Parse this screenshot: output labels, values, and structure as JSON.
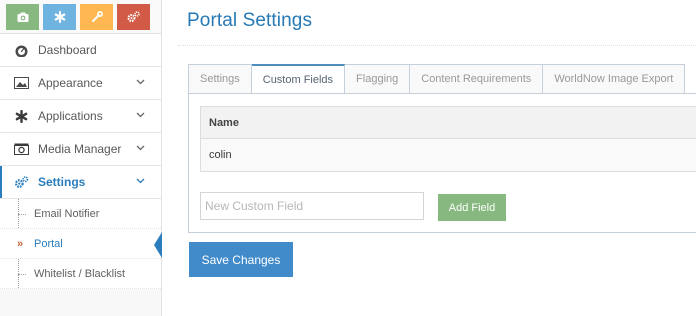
{
  "sidebar": {
    "shortcuts": [
      {
        "icon": "camera-icon",
        "color": "#87b87f"
      },
      {
        "icon": "asterisk-icon",
        "color": "#6fb3e0"
      },
      {
        "icon": "wrench-icon",
        "color": "#ffb752"
      },
      {
        "icon": "cogs-icon",
        "color": "#d15b47"
      }
    ],
    "items": [
      {
        "label": "Dashboard",
        "icon": "dashboard-icon"
      },
      {
        "label": "Appearance",
        "icon": "picture-icon"
      },
      {
        "label": "Applications",
        "icon": "asterisk-icon"
      },
      {
        "label": "Media Manager",
        "icon": "camera-icon"
      },
      {
        "label": "Settings",
        "icon": "cogs-icon",
        "active": true
      }
    ],
    "submenu": [
      {
        "label": "Email Notifier"
      },
      {
        "label": "Portal",
        "active": true
      },
      {
        "label": "Whitelist / Blacklist"
      }
    ],
    "accent_color": "#2b7dbc"
  },
  "main": {
    "title": "Portal Settings",
    "tabs": [
      {
        "label": "Settings"
      },
      {
        "label": "Custom Fields",
        "active": true
      },
      {
        "label": "Flagging"
      },
      {
        "label": "Content Requirements"
      },
      {
        "label": "WorldNow Image Export"
      }
    ],
    "table": {
      "header": "Name",
      "rows": [
        "colin"
      ]
    },
    "new_field": {
      "placeholder": "New Custom Field",
      "value": ""
    },
    "add_button": "Add Field",
    "save_button": "Save Changes"
  }
}
